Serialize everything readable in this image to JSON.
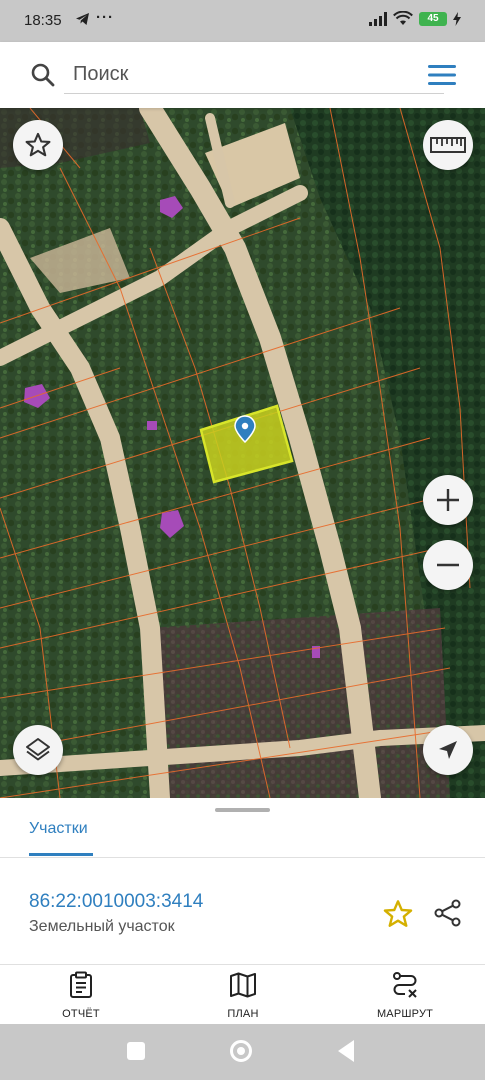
{
  "status_bar": {
    "time": "18:35",
    "telegram_icon": "telegram-icon",
    "more_dots": "···",
    "battery": "45",
    "icons": [
      "signal-icon",
      "wifi-icon",
      "battery-icon",
      "charging-icon"
    ]
  },
  "search": {
    "placeholder": "Поиск",
    "value": "",
    "search_icon": "search-icon",
    "menu_icon": "hamburger-menu-icon"
  },
  "map": {
    "highlight_color": "#c9d11f",
    "marker_color": "#2f7fbf",
    "boundary_color": "#e86a2a",
    "buttons": [
      "favorite-star-icon",
      "ruler-icon",
      "zoom-in-icon",
      "zoom-out-icon",
      "layers-icon",
      "locate-arrow-icon"
    ]
  },
  "sheet": {
    "tab_label": "Участки",
    "parcel_id": "86:22:0010003:3414",
    "parcel_type": "Земельный участок",
    "accent_color": "#2f7fbf"
  },
  "bottom_nav": {
    "report_label": "ОТЧЁТ",
    "plan_label": "ПЛАН",
    "route_label": "МАРШРУТ"
  }
}
